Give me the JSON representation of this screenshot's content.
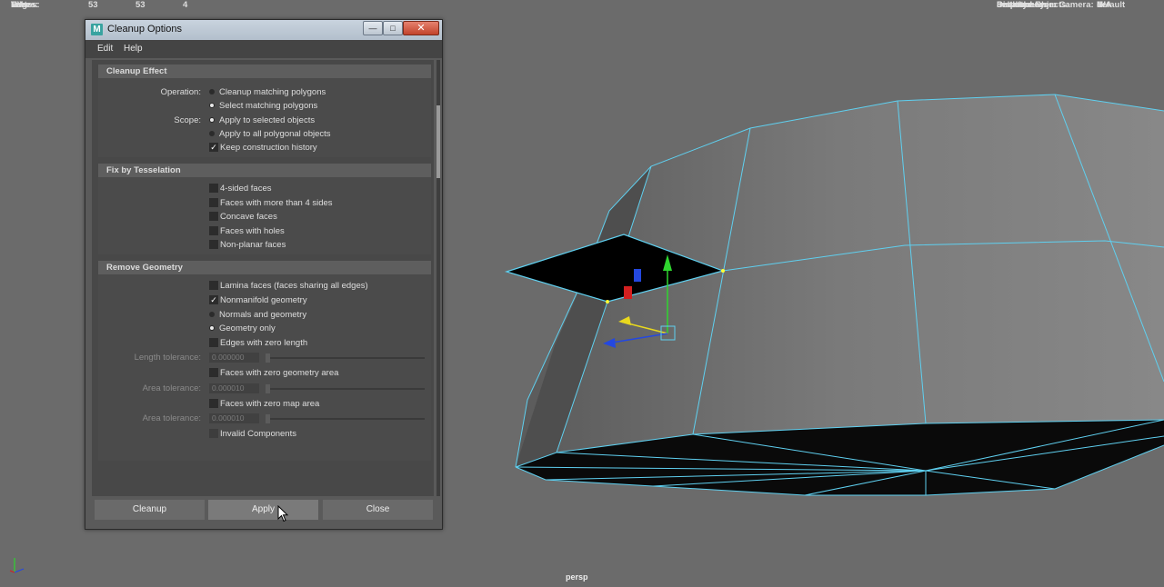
{
  "hud_left": {
    "rows": [
      {
        "label": "Verts:",
        "a": "53",
        "b": "53",
        "c": "4"
      },
      {
        "label": "Edges:",
        "a": "",
        "b": "",
        "c": ""
      },
      {
        "label": "Faces:",
        "a": "",
        "b": "",
        "c": ""
      },
      {
        "label": "Tris:",
        "a": "",
        "b": "",
        "c": ""
      },
      {
        "label": "UVs:",
        "a": "",
        "b": "",
        "c": ""
      }
    ]
  },
  "hud_right": {
    "rows": [
      {
        "label": "Backfaces:",
        "value": "N/A"
      },
      {
        "label": "Smoothness:",
        "value": "N/A"
      },
      {
        "label": "Instance:",
        "value": "N/A"
      },
      {
        "label": "Display Layer:",
        "value": "default"
      },
      {
        "label": "Distance From Camera:",
        "value": "N/A"
      },
      {
        "label": "Selected Objects:",
        "value": "1"
      }
    ]
  },
  "viewport": {
    "camera_label": "persp",
    "wire_color": "#5fd0f0",
    "selected_face_color": "#000000"
  },
  "dialog": {
    "title": "Cleanup Options",
    "app_icon": "M",
    "menus": [
      "Edit",
      "Help"
    ],
    "cleanup_effect": {
      "header": "Cleanup Effect",
      "operation_label": "Operation:",
      "operation_options": [
        "Cleanup matching polygons",
        "Select matching polygons"
      ],
      "operation_selected": 1,
      "scope_label": "Scope:",
      "scope_options": [
        "Apply to selected objects",
        "Apply to all polygonal objects"
      ],
      "scope_selected": 0,
      "keep_history": "Keep construction history",
      "keep_history_checked": true
    },
    "fix_tesselation": {
      "header": "Fix by Tesselation",
      "options": [
        "4-sided faces",
        "Faces with more than 4 sides",
        "Concave faces",
        "Faces with holes",
        "Non-planar faces"
      ]
    },
    "remove_geometry": {
      "header": "Remove Geometry",
      "lamina": "Lamina faces (faces sharing all edges)",
      "nonmanifold": "Nonmanifold geometry",
      "nonmanifold_checked": true,
      "nm_options": [
        "Normals and geometry",
        "Geometry only"
      ],
      "nm_selected": 1,
      "zero_edges": "Edges with zero length",
      "length_tol_label": "Length tolerance:",
      "length_tol_value": "0.000000",
      "zero_geo_area": "Faces with zero geometry area",
      "area_tol_label": "Area tolerance:",
      "area_tol_value": "0.000010",
      "zero_map_area": "Faces with zero map area",
      "area_tol2_label": "Area tolerance:",
      "area_tol2_value": "0.000010",
      "invalid": "Invalid Components"
    },
    "buttons": {
      "cleanup": "Cleanup",
      "apply": "Apply",
      "close": "Close"
    },
    "close_glyph": "✕",
    "min_glyph": "—",
    "max_glyph": "□"
  }
}
